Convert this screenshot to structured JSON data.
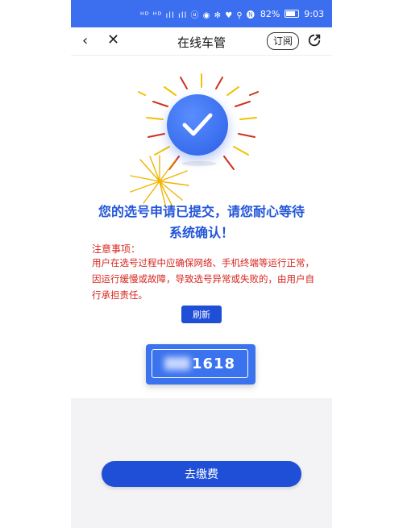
{
  "status_bar": {
    "icons_text": "ᴴᴰ ᴴᴰ ıll ıll ⓤ ◉ ✻ ♥ ⚲ 🅝",
    "battery_pct": "82%",
    "time": "9:03"
  },
  "nav": {
    "title": "在线车管",
    "subscribe_label": "订阅"
  },
  "result": {
    "headline_line1": "您的选号申请已提交，请您耐心等待",
    "headline_line2": "系统确认！",
    "notice_title": "注意事项：",
    "notice_body": "用户在选号过程中应确保网络、手机终端等运行正常，因运行缓慢或故障，导致选号异常或失败的，由用户自行承担责任。",
    "refresh_label": "刷新",
    "plate_number_visible": "1618"
  },
  "footer": {
    "pay_label": "去缴费"
  },
  "colors": {
    "status_bar": "#3c6ff0",
    "primary_button": "#1f4fd6",
    "headline": "#2255d8",
    "notice": "#d6261f",
    "footer_bg": "#f3f3f5"
  }
}
